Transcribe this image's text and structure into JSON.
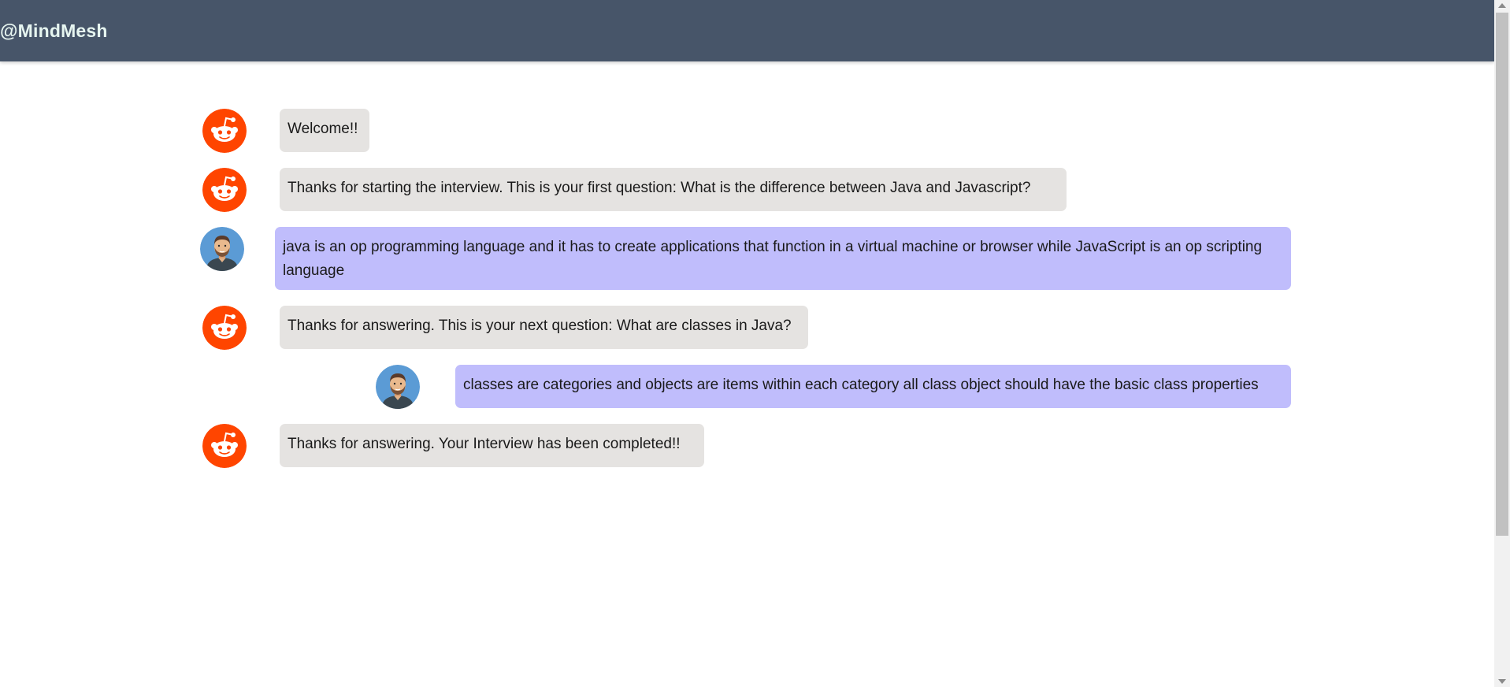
{
  "header": {
    "brand": "@MindMesh"
  },
  "colors": {
    "header_bg": "#475569",
    "bot_bubble": "#e5e3e1",
    "user_bubble": "#c0bdfc",
    "bot_avatar": "#ff4500"
  },
  "icons": {
    "bot_avatar": "reddit-alien-icon",
    "user_avatar": "man-avatar-icon"
  },
  "messages": [
    {
      "sender": "bot",
      "text": "Welcome!!"
    },
    {
      "sender": "bot",
      "text": "Thanks for starting the interview. This is your first question: What is the difference between Java and Javascript?"
    },
    {
      "sender": "user",
      "text": "java is an op programming language and it has to create applications that function in a virtual machine or browser while JavaScript is an op scripting language"
    },
    {
      "sender": "bot",
      "text": "Thanks for answering. This is your next question: What are classes in Java?"
    },
    {
      "sender": "user",
      "text": "classes are categories and objects are items within each category all class object should have the basic class properties"
    },
    {
      "sender": "bot",
      "text": "Thanks for answering. Your Interview has been completed!!"
    }
  ]
}
